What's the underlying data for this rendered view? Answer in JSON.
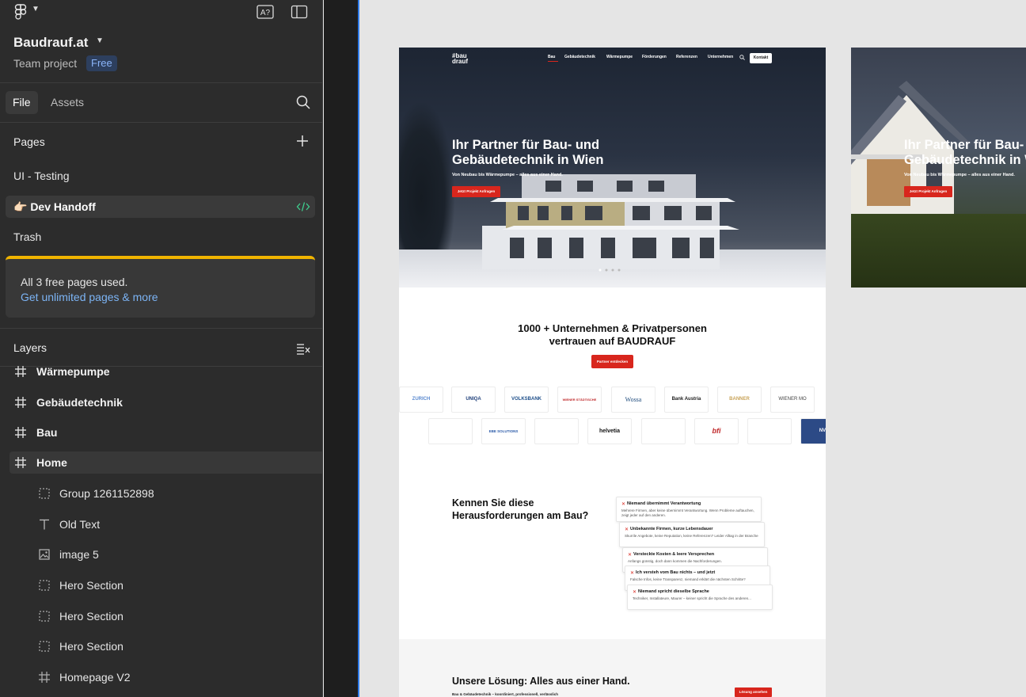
{
  "project": {
    "name": "Baudrauf.at",
    "team": "Team project",
    "plan_badge": "Free"
  },
  "tabs": {
    "file": "File",
    "assets": "Assets"
  },
  "pages": {
    "title": "Pages",
    "items": [
      "UI - Testing",
      "👉🏻 Dev Handoff",
      "Trash"
    ]
  },
  "notice": {
    "line1": "All 3 free pages used.",
    "line2": "Get unlimited pages & more"
  },
  "layers": {
    "title": "Layers",
    "items": [
      {
        "label": "Wärmepumpe",
        "icon": "frame-icon"
      },
      {
        "label": "Gebäudetechnik",
        "icon": "frame-icon"
      },
      {
        "label": "Bau",
        "icon": "frame-icon"
      },
      {
        "label": "Home",
        "icon": "frame-icon"
      },
      {
        "label": "Group 1261152898",
        "icon": "group-icon"
      },
      {
        "label": "Old Text",
        "icon": "text-icon"
      },
      {
        "label": "image 5",
        "icon": "image-icon"
      },
      {
        "label": "Hero Section",
        "icon": "group-icon"
      },
      {
        "label": "Hero Section",
        "icon": "group-icon"
      },
      {
        "label": "Hero Section",
        "icon": "group-icon"
      },
      {
        "label": "Homepage V2",
        "icon": "frame-icon"
      }
    ]
  },
  "site": {
    "logo_line1": "#bau",
    "logo_line2": "drauf",
    "nav": [
      "Bau",
      "Gebäudetechnik",
      "Wärmepumpe",
      "Förderungen",
      "Referenzen",
      "Unternehmen"
    ],
    "nav_cta": "Kontakt",
    "hero_title": "Ihr Partner für Bau- und Gebäudetechnik in Wien",
    "hero_sub": "Von Neubau bis Wärmepumpe – alles aus einer Hand.",
    "hero_cta": "Jetzt Projekt Anfragen",
    "trust_title_1": "1000 + Unternehmen & Privatpersonen",
    "trust_title_2": "vertrauen auf BAUDRAUF",
    "trust_cta": "Partner entdecken",
    "logos_row1": [
      "ZURICH",
      "UNIQA",
      "VOLKSBANK",
      "WIENER STÄDTISCHE",
      "Wossa",
      "Bank Austria",
      "BANNER",
      "WIENER MO"
    ],
    "logos_row2": [
      "",
      "EBE SOLUTIONS",
      "",
      "helvetia",
      "",
      "bfi",
      "",
      "NV"
    ],
    "problems_title_1": "Kennen Sie diese",
    "problems_title_2": "Herausforderungen am Bau?",
    "problems": [
      {
        "title": "Niemand übernimmt Verantwortung",
        "text": "Mehrere Firmen, aber keine übernimmt Verantwortung. Wenn Probleme auftauchen, zeigt jeder auf den anderen."
      },
      {
        "title": "Unbekannte Firmen, kurze Lebensdauer",
        "text": "Skurrile Angebote, keine Reputation, keine Referenzen? Leider Alltag in der Branche"
      },
      {
        "title": "Versteckte Kosten & leere Versprechen",
        "text": "Anfangs günstig, doch dann kommen die Nachforderungen."
      },
      {
        "title": "Ich versteh vom Bau nichts – und jetzt",
        "text": "Falsche Infos, keine Transparenz, niemand erklärt die nächsten Schritte?"
      },
      {
        "title": "Niemand spricht dieselbe Sprache",
        "text": "Techniker, Installateure, Maurer – keiner spricht die Sprache des anderen..."
      }
    ],
    "solution_title": "Unsere Lösung: Alles aus einer Hand.",
    "solution_sub": "Bau & Gebäudetechnik – koordiniert, professionell, verlässlich",
    "solution_cta": "Lösung ansehen"
  },
  "site2": {
    "hero_title_1": "Ihr Partner für Bau-",
    "hero_title_2": "Gebäudetechnik in W",
    "hero_sub": "Von Neubau bis Wärmepumpe – alles aus einer Hand.",
    "hero_cta": "Jetzt Projekt Anfragen"
  },
  "colors": {
    "accent_red": "#d8261d",
    "link_blue": "#7cb4f5",
    "selection_blue": "#2f7bea",
    "notice_yellow": "#f0b400"
  }
}
